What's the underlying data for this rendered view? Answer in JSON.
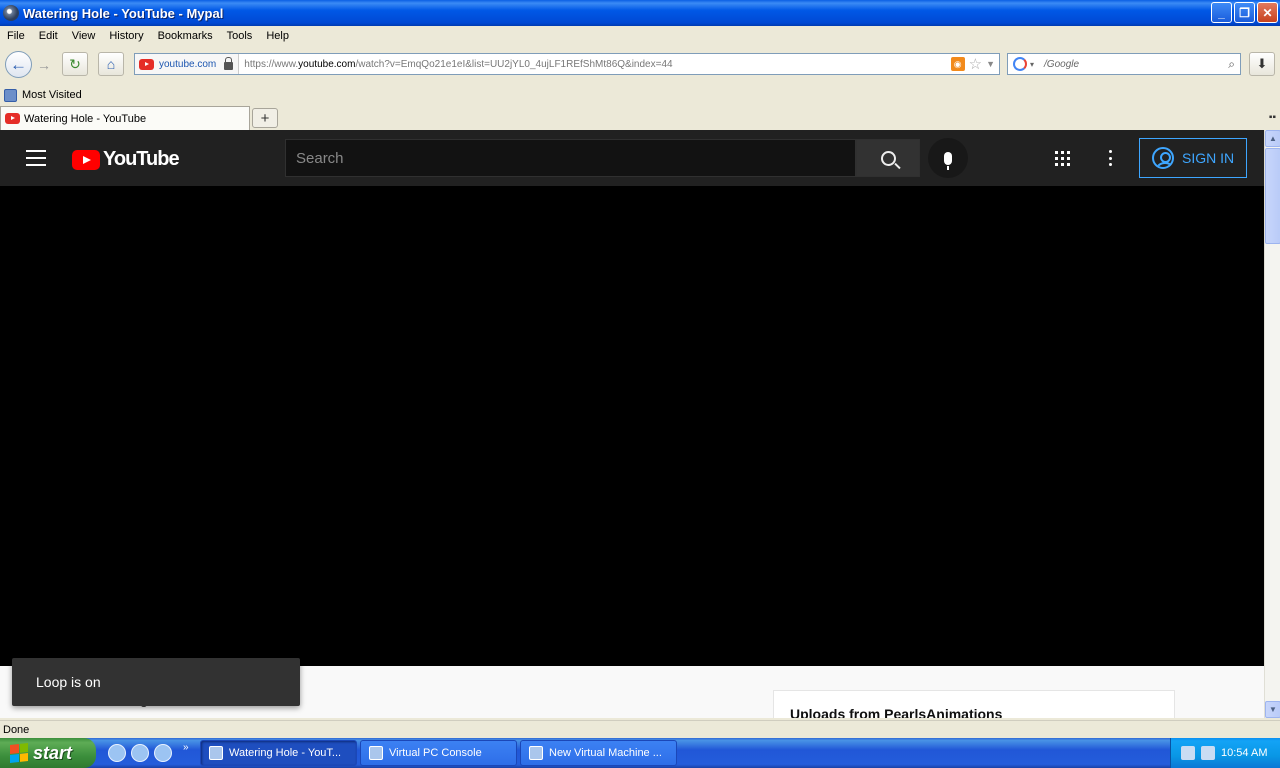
{
  "window": {
    "title": "Watering Hole - YouTube - Mypal",
    "minimize": "_",
    "restore": "❐",
    "close": "✕"
  },
  "menu": [
    "File",
    "Edit",
    "View",
    "History",
    "Bookmarks",
    "Tools",
    "Help"
  ],
  "navbar": {
    "identity": "youtube.com",
    "url_prefix": "https://www.",
    "url_host": "youtube.com",
    "url_rest": "/watch?v=EmqQo21e1eI&list=UU2jYL0_4ujLF1REfShMt86Q&index=44",
    "search_engine_text": "/Google",
    "back_icon": "←",
    "forward_icon": "→",
    "reload_icon": "↻",
    "home_icon": "⌂",
    "download_icon": "⬇"
  },
  "bookmarks": {
    "most_visited": "Most Visited"
  },
  "tabs": [
    {
      "label": "Watering Hole - YouTube"
    }
  ],
  "newtab_label": "+",
  "youtube": {
    "wordmark": "YouTube",
    "search_placeholder": "Search",
    "signin_label": "SIGN IN",
    "under_text": "g",
    "playlist_title": "Uploads from PearlsAnimations",
    "toast": "Loop is on"
  },
  "status": "Done",
  "taskbar": {
    "start": "start",
    "quicklaunch_more": "»",
    "items": [
      {
        "label": "Watering Hole - YouT..."
      },
      {
        "label": "Virtual PC Console"
      },
      {
        "label": "New Virtual Machine ..."
      }
    ],
    "clock": "10:54 AM"
  }
}
